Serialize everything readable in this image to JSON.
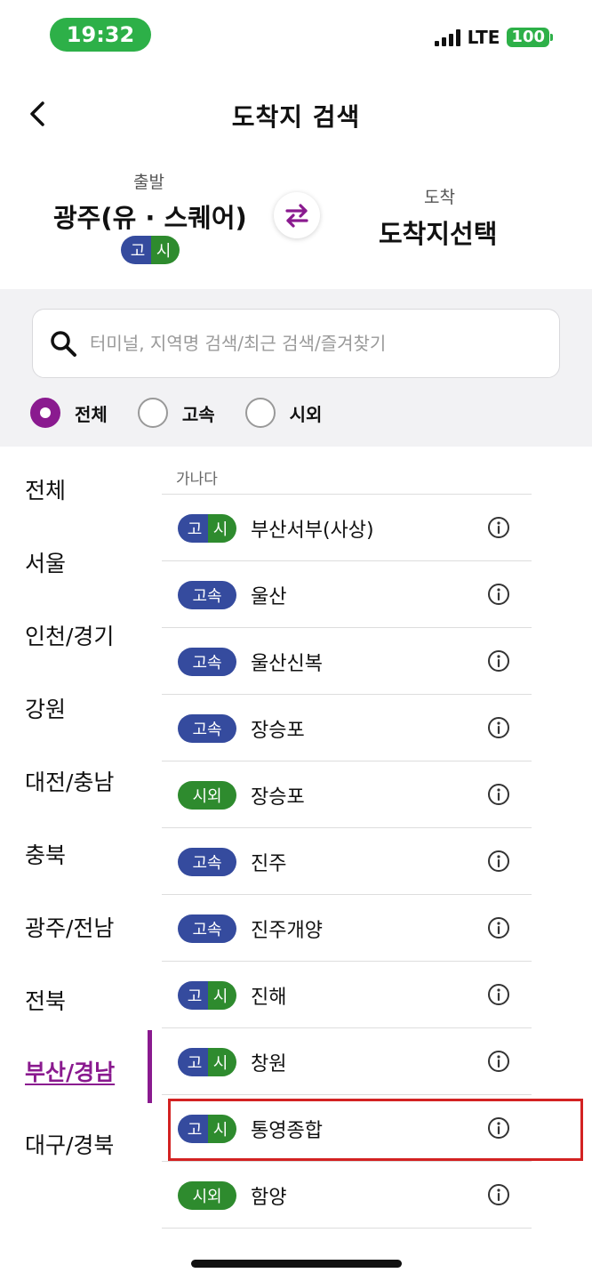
{
  "status_bar": {
    "time": "19:32",
    "network": "LTE",
    "battery": "100"
  },
  "header": {
    "title": "도착지 검색"
  },
  "route": {
    "departure_label": "출발",
    "departure_value": "광주(유 · 스퀘어)",
    "departure_badge": [
      "고",
      "시"
    ],
    "arrival_label": "도착",
    "arrival_value": "도착지선택"
  },
  "search": {
    "placeholder": "터미널, 지역명 검색/최근 검색/즐겨찾기"
  },
  "filters": [
    {
      "label": "전체",
      "checked": true
    },
    {
      "label": "고속",
      "checked": false
    },
    {
      "label": "시외",
      "checked": false
    }
  ],
  "regions": [
    "전체",
    "서울",
    "인천/경기",
    "강원",
    "대전/충남",
    "충북",
    "광주/전남",
    "전북",
    "부산/경남",
    "대구/경북"
  ],
  "selected_region": "부산/경남",
  "terminal_section_label": "가나다",
  "terminals": [
    {
      "type": "combo",
      "badge": [
        "고",
        "시"
      ],
      "name": "부산서부(사상)"
    },
    {
      "type": "express",
      "badge": "고속",
      "name": "울산"
    },
    {
      "type": "express",
      "badge": "고속",
      "name": "울산신복"
    },
    {
      "type": "express",
      "badge": "고속",
      "name": "장승포"
    },
    {
      "type": "intercity",
      "badge": "시외",
      "name": "장승포"
    },
    {
      "type": "express",
      "badge": "고속",
      "name": "진주"
    },
    {
      "type": "express",
      "badge": "고속",
      "name": "진주개양"
    },
    {
      "type": "combo",
      "badge": [
        "고",
        "시"
      ],
      "name": "진해"
    },
    {
      "type": "combo",
      "badge": [
        "고",
        "시"
      ],
      "name": "창원"
    },
    {
      "type": "combo",
      "badge": [
        "고",
        "시"
      ],
      "name": "통영종합",
      "highlighted": true
    },
    {
      "type": "intercity",
      "badge": "시외",
      "name": "함양"
    }
  ],
  "colors": {
    "accent": "#8a1a8f",
    "express_badge": "#354b9e",
    "intercity_badge": "#2e8b2e",
    "status_green": "#2db048",
    "highlight": "#d32222"
  },
  "icons": {
    "back": "chevron-left-icon",
    "swap": "swap-arrows-icon",
    "search": "search-icon",
    "info": "info-icon"
  }
}
